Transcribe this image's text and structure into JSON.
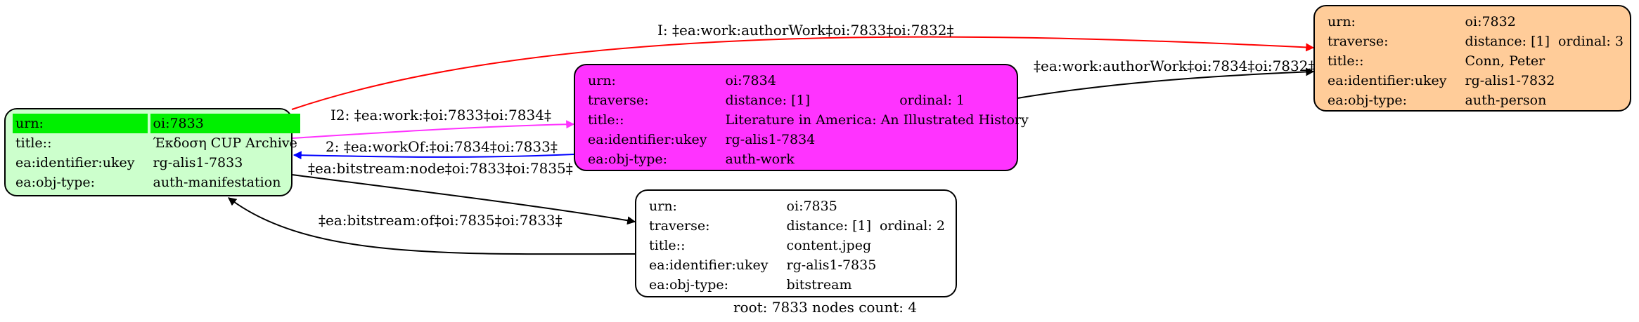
{
  "graph": {
    "footer": "root: 7833 nodes count: 4",
    "nodes": {
      "n7833": {
        "fill": "#ccffcc",
        "rows": [
          {
            "k": "urn:",
            "v": "oi:7833"
          },
          {
            "k": "title::",
            "v": "Έκδοση CUP Archive"
          },
          {
            "k": "ea:identifier:ukey",
            "v": "rg-alis1-7833"
          },
          {
            "k": "ea:obj-type:",
            "v": "auth-manifestation"
          }
        ]
      },
      "n7834": {
        "fill": "#ff33ff",
        "rows": [
          {
            "k": "urn:",
            "v": "oi:7834"
          },
          {
            "k": "traverse:",
            "v": "distance: [1]",
            "v2": "ordinal: 1"
          },
          {
            "k": "title::",
            "v": "Literature in America: An Illustrated History"
          },
          {
            "k": "ea:identifier:ukey",
            "v": "rg-alis1-7834"
          },
          {
            "k": "ea:obj-type:",
            "v": "auth-work"
          }
        ]
      },
      "n7835": {
        "fill": "#ffffff",
        "rows": [
          {
            "k": "urn:",
            "v": "oi:7835"
          },
          {
            "k": "traverse:",
            "v": "distance: [1]",
            "v2": "ordinal: 2"
          },
          {
            "k": "title::",
            "v": "content.jpeg"
          },
          {
            "k": "ea:identifier:ukey",
            "v": "rg-alis1-7835"
          },
          {
            "k": "ea:obj-type:",
            "v": "bitstream"
          }
        ]
      },
      "n7832": {
        "fill": "#ffcc99",
        "rows": [
          {
            "k": "urn:",
            "v": "oi:7832"
          },
          {
            "k": "traverse:",
            "v": "distance: [1]",
            "v2": "ordinal: 3"
          },
          {
            "k": "title::",
            "v": "Conn, Peter"
          },
          {
            "k": "ea:identifier:ukey",
            "v": "rg-alis1-7832"
          },
          {
            "k": "ea:obj-type:",
            "v": "auth-person"
          }
        ]
      }
    },
    "edges": {
      "e1": {
        "label": "I: ‡ea:work:authorWork‡oi:7833‡oi:7832‡",
        "color": "#ff0000"
      },
      "e2": {
        "label": "I2: ‡ea:work:‡oi:7833‡oi:7834‡",
        "color": "#ff33ff"
      },
      "e3": {
        "label": "2: ‡ea:workOf:‡oi:7834‡oi:7833‡",
        "color": "#0000ff"
      },
      "e4": {
        "label": "‡ea:work:authorWork‡oi:7834‡oi:7832‡",
        "color": "#000000"
      },
      "e5": {
        "label": "‡ea:bitstream:node‡oi:7833‡oi:7835‡",
        "color": "#000000"
      },
      "e6": {
        "label": "‡ea:bitstream:of‡oi:7835‡oi:7833‡",
        "color": "#000000"
      }
    }
  }
}
